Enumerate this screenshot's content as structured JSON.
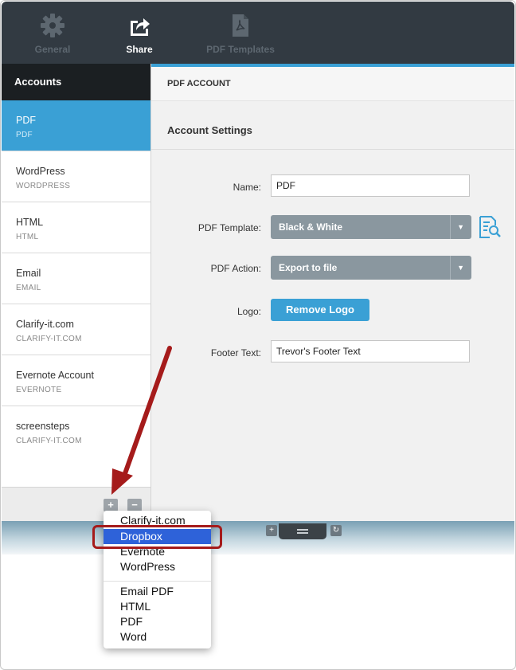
{
  "toolbar": {
    "items": [
      {
        "label": "General",
        "icon": "gear-icon"
      },
      {
        "label": "Share",
        "icon": "share-icon"
      },
      {
        "label": "PDF Templates",
        "icon": "pdf-file-icon"
      }
    ]
  },
  "sidebar": {
    "title": "Accounts",
    "accounts": [
      {
        "name": "PDF",
        "type": "PDF"
      },
      {
        "name": "WordPress",
        "type": "WORDPRESS"
      },
      {
        "name": "HTML",
        "type": "HTML"
      },
      {
        "name": "Email",
        "type": "EMAIL"
      },
      {
        "name": "Clarify-it.com",
        "type": "CLARIFY-IT.COM"
      },
      {
        "name": "Evernote Account",
        "type": "EVERNOTE"
      },
      {
        "name": "screensteps",
        "type": "CLARIFY-IT.COM"
      }
    ],
    "add_label": "+",
    "remove_label": "−"
  },
  "main": {
    "header": "PDF ACCOUNT",
    "section_title": "Account Settings",
    "name_label": "Name:",
    "name_value": "PDF",
    "template_label": "PDF Template:",
    "template_value": "Black & White",
    "action_label": "PDF Action:",
    "action_value": "Export to file",
    "logo_label": "Logo:",
    "logo_button": "Remove Logo",
    "footer_label": "Footer Text:",
    "footer_value": "Trevor's Footer Text"
  },
  "menu": {
    "items": [
      "Clarify-it.com",
      "Dropbox",
      "Evernote",
      "WordPress"
    ],
    "items2": [
      "Email PDF",
      "HTML",
      "PDF",
      "Word"
    ],
    "highlighted": "Dropbox"
  },
  "colors": {
    "accent": "#3aa0d5",
    "toolbar": "#323a42",
    "annotation": "#a51b1b",
    "menu_highlight": "#2e62d9"
  }
}
